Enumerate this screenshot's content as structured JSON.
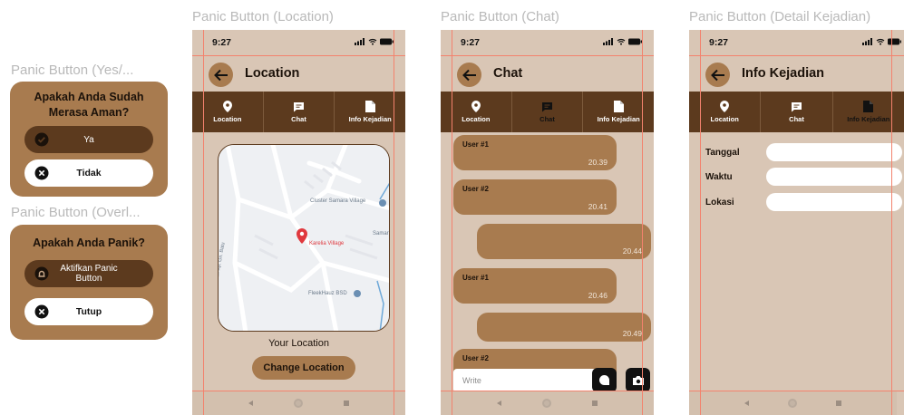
{
  "frames": {
    "yes_no": "Panic Button (Yes/...",
    "overlay": "Panic Button (Overl...",
    "location": "Panic Button (Location)",
    "chat": "Panic Button (Chat)",
    "detail": "Panic Button (Detail Kejadian)"
  },
  "dialog_safe": {
    "title_line1": "Apakah Anda Sudah",
    "title_line2": "Merasa Aman?",
    "yes_label": "Ya",
    "no_label": "Tidak"
  },
  "dialog_panic": {
    "title": "Apakah Anda Panik?",
    "activate_label": "Aktifkan Panic Button",
    "close_label": "Tutup"
  },
  "status_bar": {
    "time": "9:27"
  },
  "tabs": {
    "location": "Location",
    "chat": "Chat",
    "info": "Info Kejadian"
  },
  "location_screen": {
    "title": "Location",
    "map_labels": {
      "place1": "Cluster Samara Village",
      "place2": "Karelia Village",
      "place3": "Samar",
      "place4": "FleekHauz BSD",
      "road": "Jl. Kp. Gn. Batu"
    },
    "your_location": "Your Location",
    "change_location": "Change Location"
  },
  "chat_screen": {
    "title": "Chat",
    "messages": [
      {
        "user": "User #1",
        "time": "20.39"
      },
      {
        "user": "User #2",
        "time": "20.41"
      },
      {
        "user": "",
        "time": "20.44"
      },
      {
        "user": "User #1",
        "time": "20.46"
      },
      {
        "user": "",
        "time": "20.49"
      },
      {
        "user": "User #2",
        "time": ""
      }
    ],
    "compose_placeholder": "Write"
  },
  "info_screen": {
    "title": "Info Kejadian",
    "fields": [
      {
        "label": "Tanggal",
        "value": ""
      },
      {
        "label": "Waktu",
        "value": ""
      },
      {
        "label": "Lokasi",
        "value": ""
      }
    ]
  },
  "colors": {
    "primary_brown": "#a87b4f",
    "dark_brown": "#5c3a1e",
    "background_beige": "#d9c6b5",
    "guide_line": "#f3826d",
    "map_pin": "#e0393e"
  },
  "icons": {
    "back": "arrow-left-icon",
    "location": "map-pin-icon",
    "chat": "chat-bubble-icon",
    "info": "document-icon",
    "check": "check-circle-icon",
    "close": "x-circle-icon",
    "panic": "alarm-icon",
    "send": "send-icon",
    "camera": "camera-icon"
  }
}
